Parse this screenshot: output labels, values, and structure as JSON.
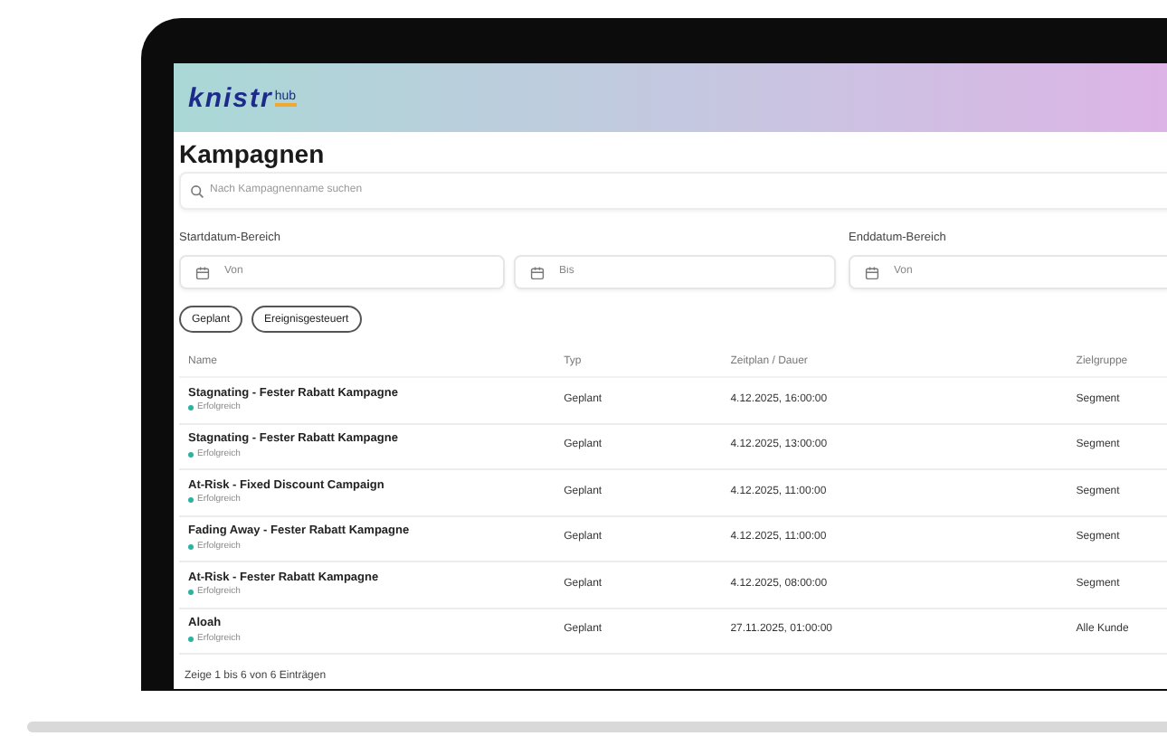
{
  "logo": {
    "text": "knistr",
    "suffix": "hub"
  },
  "title": "Kampagnen",
  "search": {
    "placeholder": "Nach Kampagnenname suchen"
  },
  "start_range": {
    "label": "Startdatum-Bereich",
    "fields": [
      {
        "placeholder": "Von"
      },
      {
        "placeholder": "Bis"
      }
    ]
  },
  "end_range": {
    "label": "Enddatum-Bereich",
    "fields": [
      {
        "placeholder": "Von"
      }
    ]
  },
  "filters": [
    {
      "label": "Geplant",
      "selected": false
    },
    {
      "label": "Ereignisgesteuert",
      "selected": false
    }
  ],
  "table": {
    "columns": [
      "Name",
      "Typ",
      "Zeitplan / Dauer",
      "Zielgruppe"
    ],
    "rows": [
      {
        "name": "Stagnating - Fester Rabatt Kampagne",
        "status": "Erfolgreich",
        "color": "#2bb3a0",
        "type": "Geplant",
        "schedule": "4.12.2025, 16:00:00",
        "audience": "Segment"
      },
      {
        "name": "Stagnating - Fester Rabatt Kampagne",
        "status": "Erfolgreich",
        "color": "#2bb3a0",
        "type": "Geplant",
        "schedule": "4.12.2025, 13:00:00",
        "audience": "Segment"
      },
      {
        "name": "At-Risk - Fixed Discount Campaign",
        "status": "Erfolgreich",
        "color": "#2bb3a0",
        "type": "Geplant",
        "schedule": "4.12.2025, 11:00:00",
        "audience": "Segment"
      },
      {
        "name": "Fading Away - Fester Rabatt Kampagne",
        "status": "Erfolgreich",
        "color": "#2bb3a0",
        "type": "Geplant",
        "schedule": "4.12.2025, 11:00:00",
        "audience": "Segment"
      },
      {
        "name": "At-Risk - Fester Rabatt Kampagne",
        "status": "Erfolgreich",
        "color": "#2bb3a0",
        "type": "Geplant",
        "schedule": "4.12.2025, 08:00:00",
        "audience": "Segment"
      },
      {
        "name": "Aloah",
        "status": "Erfolgreich",
        "color": "#2bb3a0",
        "type": "Geplant",
        "schedule": "27.11.2025, 01:00:00",
        "audience": "Alle Kunde"
      }
    ]
  },
  "footer": "Zeige 1 bis 6 von 6 Einträgen"
}
